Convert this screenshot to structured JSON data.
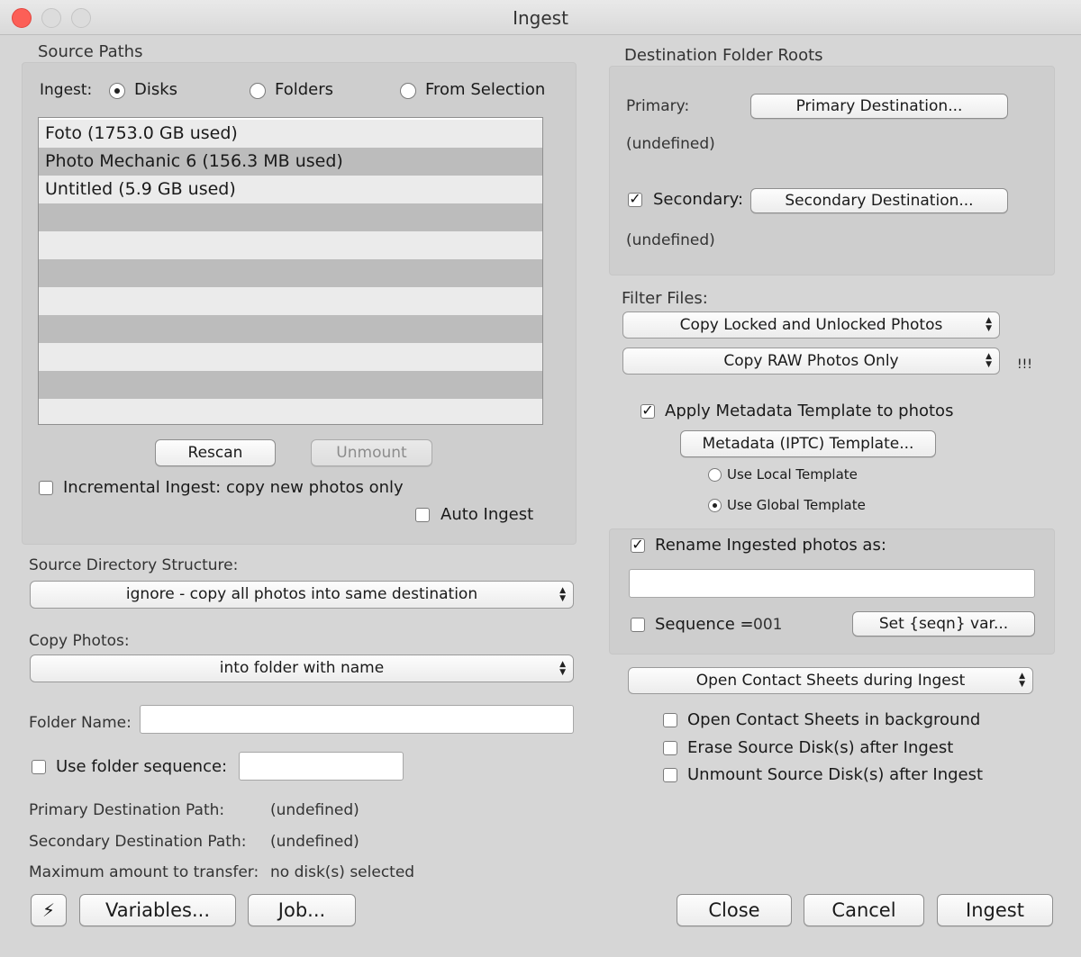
{
  "window": {
    "title": "Ingest"
  },
  "source": {
    "heading": "Source Paths",
    "ingest_label": "Ingest:",
    "radios": [
      "Disks",
      "Folders",
      "From Selection"
    ],
    "disks": [
      "Foto   (1753.0 GB used)",
      "Photo Mechanic 6   (156.3 MB used)",
      "Untitled   (5.9 GB used)"
    ],
    "rescan": "Rescan",
    "unmount": "Unmount",
    "incremental": "Incremental Ingest: copy new photos only",
    "auto_ingest": "Auto Ingest"
  },
  "structure": {
    "label": "Source Directory Structure:",
    "value": "ignore - copy all photos into same destination"
  },
  "copy": {
    "label": "Copy Photos:",
    "value": "into folder with name",
    "folder_name_label": "Folder Name:",
    "folder_name_value": "",
    "use_seq_label": "Use folder sequence:",
    "use_seq_value": ""
  },
  "paths": {
    "primary_label": "Primary Destination Path:",
    "primary_value": "(undefined)",
    "secondary_label": "Secondary Destination Path:",
    "secondary_value": "(undefined)",
    "max_label": "Maximum amount to transfer:",
    "max_value": "no disk(s) selected"
  },
  "bottom_left": {
    "variables": "Variables...",
    "job": "Job..."
  },
  "dest": {
    "heading": "Destination Folder Roots",
    "primary_label": "Primary:",
    "primary_button": "Primary Destination...",
    "primary_value": "(undefined)",
    "secondary_label": "Secondary:",
    "secondary_button": "Secondary Destination...",
    "secondary_value": "(undefined)"
  },
  "filter": {
    "label": "Filter Files:",
    "locked": "Copy Locked and Unlocked Photos",
    "raw": "Copy RAW Photos Only",
    "warn": "!!!"
  },
  "metadata": {
    "apply": "Apply Metadata Template to photos",
    "button": "Metadata (IPTC) Template...",
    "local": "Use Local Template",
    "global": "Use Global Template"
  },
  "rename": {
    "label": "Rename Ingested photos as:",
    "value": "",
    "sequence_label": "Sequence =",
    "sequence_value": "001",
    "set_button": "Set {seqn} var..."
  },
  "contact": {
    "select": "Open Contact Sheets during Ingest",
    "bg": "Open Contact Sheets in background",
    "erase": "Erase Source Disk(s) after Ingest",
    "unmount": "Unmount Source Disk(s) after Ingest"
  },
  "actions": {
    "close": "Close",
    "cancel": "Cancel",
    "ingest": "Ingest"
  },
  "icons": {
    "lightning": "⚡"
  }
}
